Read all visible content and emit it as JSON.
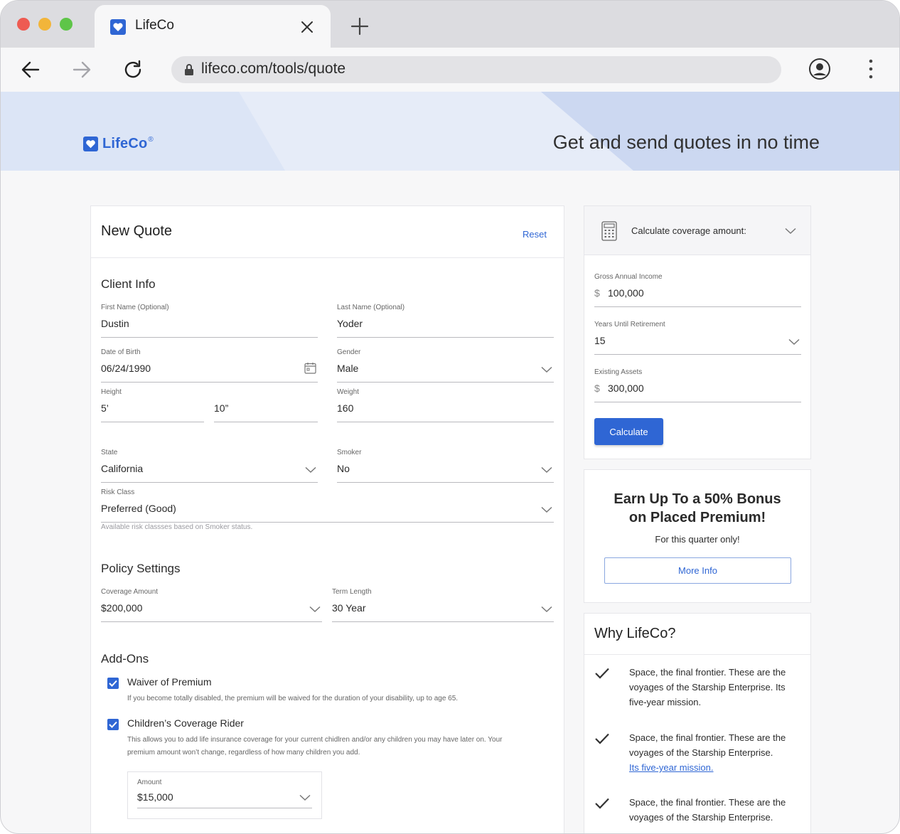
{
  "browser": {
    "tab_title": "LifeCo",
    "url": "lifeco.com/tools/quote"
  },
  "header": {
    "logo_text": "LifeCo",
    "logo_reg": "®",
    "tagline": "Get and send quotes in no time"
  },
  "quote": {
    "title": "New Quote",
    "reset_label": "Reset",
    "client_info": {
      "title": "Client Info",
      "first_name": {
        "label": "First Name (Optional)",
        "value": "Dustin"
      },
      "last_name": {
        "label": "Last Name (Optional)",
        "value": "Yoder"
      },
      "dob": {
        "label": "Date of Birth",
        "value": "06/24/1990"
      },
      "gender": {
        "label": "Gender",
        "value": "Male"
      },
      "height": {
        "label": "Height",
        "feet": "5’",
        "inches": "10”"
      },
      "weight": {
        "label": "Weight",
        "value": "160"
      },
      "state": {
        "label": "State",
        "value": "California"
      },
      "smoker": {
        "label": "Smoker",
        "value": "No"
      },
      "risk_class": {
        "label": "Risk Class",
        "value": "Preferred (Good)",
        "hint": "Available risk classses based on Smoker status."
      }
    },
    "policy": {
      "title": "Policy Settings",
      "coverage": {
        "label": "Coverage Amount",
        "value": "$200,000"
      },
      "term": {
        "label": "Term Length",
        "value": "30 Year"
      }
    },
    "addons": {
      "title": "Add-Ons",
      "waiver": {
        "label": "Waiver of Premium",
        "checked": true,
        "desc": "If you become totally disabled, the premium will be waived for the duration of your disability, up to age 65."
      },
      "children": {
        "label": "Children’s Coverage Rider",
        "checked": true,
        "desc_line1": "This allows you to add life insurance coverage for your current chidlren and/or any children you may have later on. Your",
        "desc_line2": "premium amount won’t change, regardless of how many children you add."
      },
      "amount": {
        "label": "Amount",
        "value": "$15,000"
      }
    }
  },
  "calculator": {
    "title": "Calculate coverage amount:",
    "income": {
      "label": "Gross Annual Income",
      "currency": "$",
      "value": "100,000"
    },
    "years": {
      "label": "Years Until Retirement",
      "value": "15"
    },
    "assets": {
      "label": "Existing Assets",
      "currency": "$",
      "value": "300,000"
    },
    "button_label": "Calculate"
  },
  "promo": {
    "title_line1": "Earn Up To a 50% Bonus",
    "title_line2": "on Placed Premium!",
    "subtitle": "For this quarter only!",
    "button_label": "More Info"
  },
  "why": {
    "title": "Why LifeCo?",
    "items": [
      {
        "line1": "Space, the final frontier. These are the",
        "line2": "voyages of the Starship Enterprise. Its",
        "line3": "five-year mission."
      },
      {
        "line1": "Space, the final frontier. These are the",
        "line2": "voyages of the Starship Enterprise.",
        "link": "Its five-year mission."
      },
      {
        "line1": "Space, the final frontier. These are the",
        "line2": "voyages of the Starship Enterprise."
      }
    ]
  },
  "colors": {
    "accent": "#2f66d4",
    "banner": "#dce5f6"
  }
}
